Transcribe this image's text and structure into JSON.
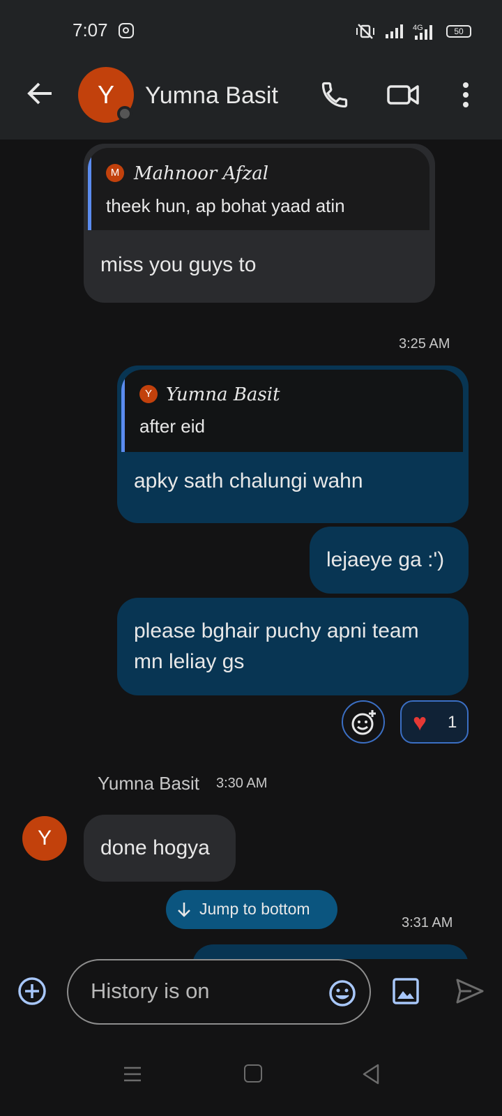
{
  "status_bar": {
    "time": "7:07",
    "battery": "50",
    "icons": [
      "instagram-icon",
      "vibrate-mute-icon",
      "signal-icon",
      "signal-4g-icon",
      "battery-icon"
    ]
  },
  "header": {
    "avatar_initial": "Y",
    "contact_name": "Yumna Basit",
    "icons": [
      "back-arrow-icon",
      "phone-icon",
      "video-camera-icon",
      "more-vert-icon"
    ]
  },
  "messages": [
    {
      "direction": "incoming",
      "reply_to": {
        "sender_initial": "M",
        "sender": "Mahnoor Afzal",
        "text": "theek hun, ap bohat yaad atin"
      },
      "text": "miss you guys to"
    },
    {
      "direction": "outgoing",
      "timestamp": "3:25 AM",
      "reply_to": {
        "sender_initial": "Y",
        "sender": "Yumna Basit",
        "text": "after eid"
      },
      "text": "apky sath chalungi wahn"
    },
    {
      "direction": "outgoing",
      "text": "lejaeye ga :')"
    },
    {
      "direction": "outgoing",
      "text_lines": [
        "please bghair puchy apni team",
        "mn leliay gs"
      ],
      "reactions": {
        "emoji": "heart",
        "count": "1"
      }
    },
    {
      "direction": "incoming",
      "sender": "Yumna Basit",
      "time": "3:30 AM",
      "avatar_initial": "Y",
      "text": "done hogya"
    },
    {
      "direction": "outgoing",
      "timestamp": "3:31 AM"
    }
  ],
  "jump_to_bottom": {
    "label": "Jump to bottom"
  },
  "compose": {
    "placeholder": "History is on"
  },
  "colors": {
    "accent": "#0b557f",
    "outgoing_bubble": "#083553",
    "incoming_bubble": "#2a2b2e",
    "avatar": "#c2410c"
  }
}
